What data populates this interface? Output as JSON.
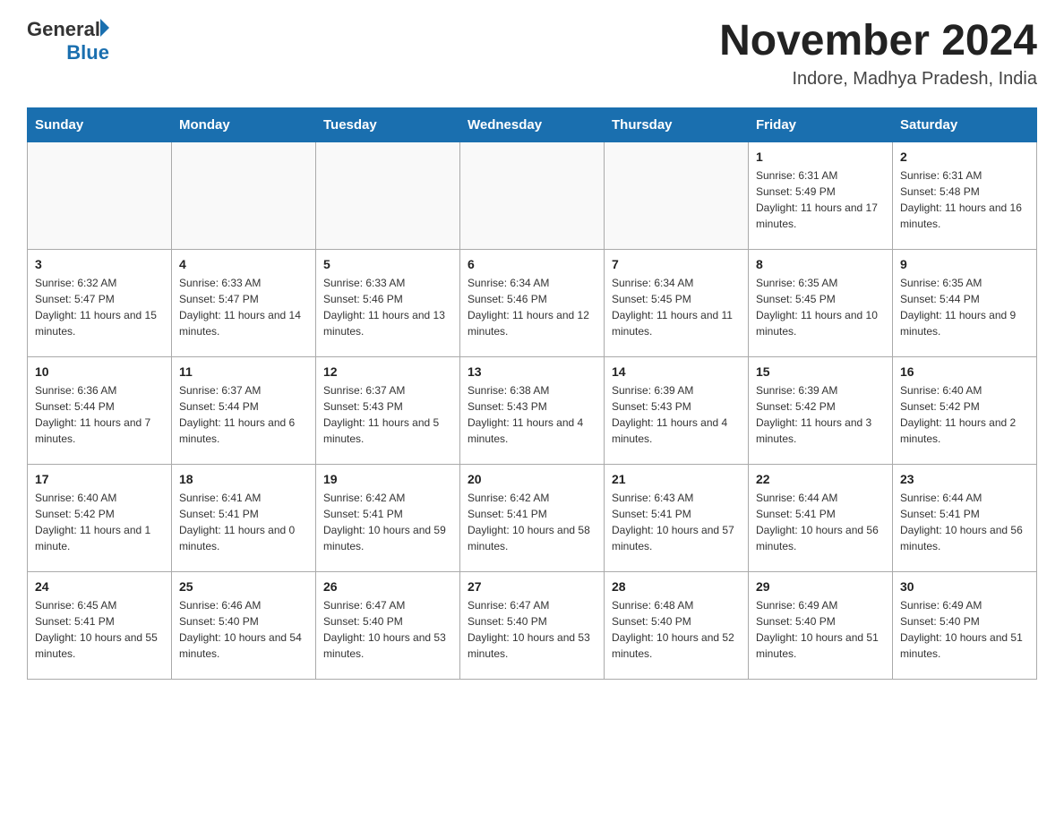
{
  "header": {
    "logo_general": "General",
    "logo_blue": "Blue",
    "month_title": "November 2024",
    "location": "Indore, Madhya Pradesh, India"
  },
  "columns": [
    "Sunday",
    "Monday",
    "Tuesday",
    "Wednesday",
    "Thursday",
    "Friday",
    "Saturday"
  ],
  "weeks": [
    [
      {
        "day": "",
        "info": ""
      },
      {
        "day": "",
        "info": ""
      },
      {
        "day": "",
        "info": ""
      },
      {
        "day": "",
        "info": ""
      },
      {
        "day": "",
        "info": ""
      },
      {
        "day": "1",
        "info": "Sunrise: 6:31 AM\nSunset: 5:49 PM\nDaylight: 11 hours and 17 minutes."
      },
      {
        "day": "2",
        "info": "Sunrise: 6:31 AM\nSunset: 5:48 PM\nDaylight: 11 hours and 16 minutes."
      }
    ],
    [
      {
        "day": "3",
        "info": "Sunrise: 6:32 AM\nSunset: 5:47 PM\nDaylight: 11 hours and 15 minutes."
      },
      {
        "day": "4",
        "info": "Sunrise: 6:33 AM\nSunset: 5:47 PM\nDaylight: 11 hours and 14 minutes."
      },
      {
        "day": "5",
        "info": "Sunrise: 6:33 AM\nSunset: 5:46 PM\nDaylight: 11 hours and 13 minutes."
      },
      {
        "day": "6",
        "info": "Sunrise: 6:34 AM\nSunset: 5:46 PM\nDaylight: 11 hours and 12 minutes."
      },
      {
        "day": "7",
        "info": "Sunrise: 6:34 AM\nSunset: 5:45 PM\nDaylight: 11 hours and 11 minutes."
      },
      {
        "day": "8",
        "info": "Sunrise: 6:35 AM\nSunset: 5:45 PM\nDaylight: 11 hours and 10 minutes."
      },
      {
        "day": "9",
        "info": "Sunrise: 6:35 AM\nSunset: 5:44 PM\nDaylight: 11 hours and 9 minutes."
      }
    ],
    [
      {
        "day": "10",
        "info": "Sunrise: 6:36 AM\nSunset: 5:44 PM\nDaylight: 11 hours and 7 minutes."
      },
      {
        "day": "11",
        "info": "Sunrise: 6:37 AM\nSunset: 5:44 PM\nDaylight: 11 hours and 6 minutes."
      },
      {
        "day": "12",
        "info": "Sunrise: 6:37 AM\nSunset: 5:43 PM\nDaylight: 11 hours and 5 minutes."
      },
      {
        "day": "13",
        "info": "Sunrise: 6:38 AM\nSunset: 5:43 PM\nDaylight: 11 hours and 4 minutes."
      },
      {
        "day": "14",
        "info": "Sunrise: 6:39 AM\nSunset: 5:43 PM\nDaylight: 11 hours and 4 minutes."
      },
      {
        "day": "15",
        "info": "Sunrise: 6:39 AM\nSunset: 5:42 PM\nDaylight: 11 hours and 3 minutes."
      },
      {
        "day": "16",
        "info": "Sunrise: 6:40 AM\nSunset: 5:42 PM\nDaylight: 11 hours and 2 minutes."
      }
    ],
    [
      {
        "day": "17",
        "info": "Sunrise: 6:40 AM\nSunset: 5:42 PM\nDaylight: 11 hours and 1 minute."
      },
      {
        "day": "18",
        "info": "Sunrise: 6:41 AM\nSunset: 5:41 PM\nDaylight: 11 hours and 0 minutes."
      },
      {
        "day": "19",
        "info": "Sunrise: 6:42 AM\nSunset: 5:41 PM\nDaylight: 10 hours and 59 minutes."
      },
      {
        "day": "20",
        "info": "Sunrise: 6:42 AM\nSunset: 5:41 PM\nDaylight: 10 hours and 58 minutes."
      },
      {
        "day": "21",
        "info": "Sunrise: 6:43 AM\nSunset: 5:41 PM\nDaylight: 10 hours and 57 minutes."
      },
      {
        "day": "22",
        "info": "Sunrise: 6:44 AM\nSunset: 5:41 PM\nDaylight: 10 hours and 56 minutes."
      },
      {
        "day": "23",
        "info": "Sunrise: 6:44 AM\nSunset: 5:41 PM\nDaylight: 10 hours and 56 minutes."
      }
    ],
    [
      {
        "day": "24",
        "info": "Sunrise: 6:45 AM\nSunset: 5:41 PM\nDaylight: 10 hours and 55 minutes."
      },
      {
        "day": "25",
        "info": "Sunrise: 6:46 AM\nSunset: 5:40 PM\nDaylight: 10 hours and 54 minutes."
      },
      {
        "day": "26",
        "info": "Sunrise: 6:47 AM\nSunset: 5:40 PM\nDaylight: 10 hours and 53 minutes."
      },
      {
        "day": "27",
        "info": "Sunrise: 6:47 AM\nSunset: 5:40 PM\nDaylight: 10 hours and 53 minutes."
      },
      {
        "day": "28",
        "info": "Sunrise: 6:48 AM\nSunset: 5:40 PM\nDaylight: 10 hours and 52 minutes."
      },
      {
        "day": "29",
        "info": "Sunrise: 6:49 AM\nSunset: 5:40 PM\nDaylight: 10 hours and 51 minutes."
      },
      {
        "day": "30",
        "info": "Sunrise: 6:49 AM\nSunset: 5:40 PM\nDaylight: 10 hours and 51 minutes."
      }
    ]
  ]
}
